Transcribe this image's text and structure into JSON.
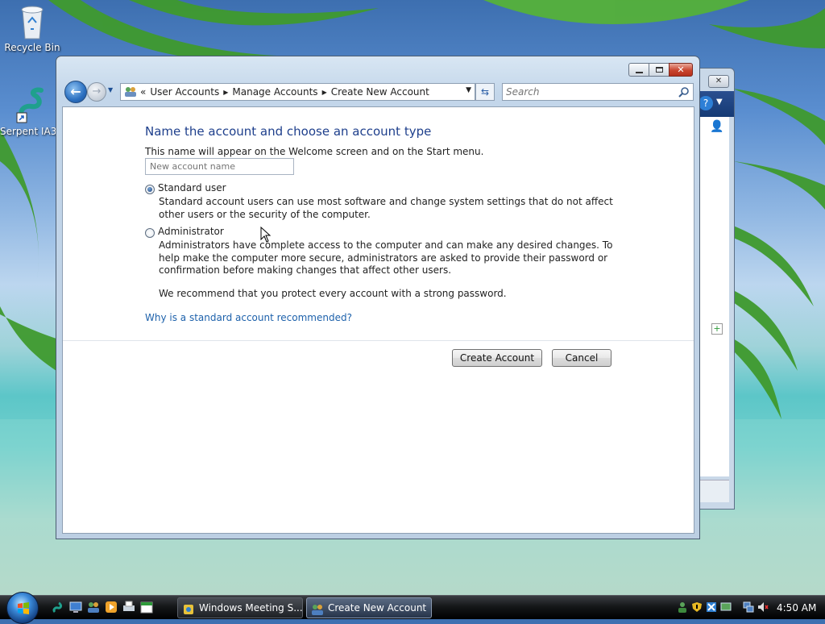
{
  "desktop": {
    "icons": [
      {
        "label": "Recycle Bin",
        "icon": "recycle-bin-icon"
      },
      {
        "label": "Serpent IA32",
        "icon": "serpent-icon"
      }
    ]
  },
  "window": {
    "title": "Create New Account",
    "controls": {
      "minimize": "minimize-icon",
      "maximize": "maximize-icon",
      "close": "close-icon"
    },
    "address": {
      "prefix": "«",
      "crumbs": [
        "User Accounts",
        "Manage Accounts",
        "Create New Account"
      ]
    },
    "search": {
      "placeholder": "Search"
    },
    "content": {
      "heading": "Name the account and choose an account type",
      "hint": "This name will appear on the Welcome screen and on the Start menu.",
      "name_placeholder": "New account name",
      "options": [
        {
          "label": "Standard user",
          "selected": true,
          "description": "Standard account users can use most software and change system settings that do not affect other users or the security of the computer."
        },
        {
          "label": "Administrator",
          "selected": false,
          "description": "Administrators have complete access to the computer and can make any desired changes. To help make the computer more secure, administrators are asked to provide their password or confirmation before making changes that affect other users."
        }
      ],
      "recommendation": "We recommend that you protect every account with a strong password.",
      "link": "Why is a standard account recommended?",
      "buttons": {
        "create": "Create Account",
        "cancel": "Cancel"
      }
    }
  },
  "taskbar": {
    "tasks": [
      {
        "label": "Windows Meeting S...",
        "icon": "meeting-space-icon",
        "active": false
      },
      {
        "label": "Create New Account",
        "icon": "user-accounts-icon",
        "active": true
      }
    ],
    "quick_launch": [
      "serpent-icon",
      "show-desktop-icon",
      "users-icon",
      "media-player-icon",
      "printer-icon",
      "calendar-icon"
    ],
    "tray": [
      "network-people-icon",
      "security-shield-icon",
      "mute-icon",
      "network-icon",
      "volume-icon"
    ],
    "clock": "4:50 AM"
  },
  "colors": {
    "heading": "#1e3f8c",
    "link": "#1d61ab",
    "taskbar": "#151719"
  }
}
